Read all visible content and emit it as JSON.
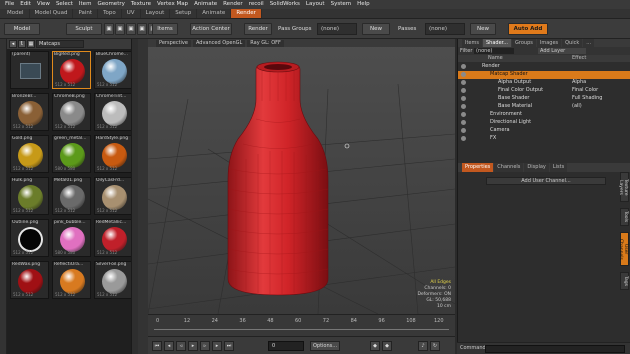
{
  "menu": [
    "File",
    "Edit",
    "View",
    "Select",
    "Item",
    "Geometry",
    "Texture",
    "Vertex Map",
    "Animate",
    "Render",
    "recoil",
    "SolidWorks",
    "Layout",
    "System",
    "Help"
  ],
  "layouts": [
    "Model",
    "Model Quad",
    "Paint",
    "Topo",
    "UV",
    "Layout",
    "Setup",
    "Animate",
    "Render"
  ],
  "active_layout": "Render",
  "toolbar": {
    "model": "Model",
    "sculpt": "Sculpt",
    "items": "Items",
    "action_center": "Action Center",
    "render": "Render",
    "pass_groups_label": "Pass Groups",
    "pass_groups_value": "(none)",
    "new1": "New",
    "passes_label": "Passes",
    "passes_value": "(none)",
    "new2": "New",
    "auto_add": "Auto Add"
  },
  "browser": {
    "filter": "Matcaps",
    "items": [
      {
        "name": "(parent)",
        "size": "",
        "color": "#3a4a55",
        "folder": true
      },
      {
        "name": "BigRed.png",
        "size": "512 x 512",
        "color": "#c0181c",
        "selected": true
      },
      {
        "name": "BlueChrome...",
        "size": "512 x 512",
        "color": "#7fa6c6"
      },
      {
        "name": "BronzeBr...",
        "size": "512 x 512",
        "color": "#8a6036"
      },
      {
        "name": "ChromeB.png",
        "size": "512 x 512",
        "color": "#8a8a8a"
      },
      {
        "name": "ChromeTint...",
        "size": "512 x 512",
        "color": "#bcbcbc"
      },
      {
        "name": "Gold.png",
        "size": "512 x 512",
        "color": "#c79a18"
      },
      {
        "name": "green_metal...",
        "size": "580 x 580",
        "color": "#5c9a1a"
      },
      {
        "name": "HardStyle.png",
        "size": "512 x 512",
        "color": "#c85a10"
      },
      {
        "name": "Hulk.png",
        "size": "512 x 512",
        "color": "#6b7d2a"
      },
      {
        "name": "Metal01.png",
        "size": "512 x 512",
        "color": "#6a6a6a"
      },
      {
        "name": "OilyCasFrd...",
        "size": "512 x 512",
        "color": "#a89070"
      },
      {
        "name": "Outline.png",
        "size": "512 x 512",
        "color": "#0a0a0a",
        "ring": true
      },
      {
        "name": "pink_bubble...",
        "size": "580 x 580",
        "color": "#e070c0"
      },
      {
        "name": "RedMetallic...",
        "size": "512 x 512",
        "color": "#c0202a"
      },
      {
        "name": "RedWax.png",
        "size": "512 x 512",
        "color": "#a01014"
      },
      {
        "name": "ReflectiOra...",
        "size": "512 x 512",
        "color": "#d87a20"
      },
      {
        "name": "SilverFoil.png",
        "size": "512 x 512",
        "color": "#9a9a9a"
      }
    ]
  },
  "viewport": {
    "tabs": [
      "Perspective",
      "Advanced OpenGL",
      "Ray GL: OFF"
    ],
    "stats": {
      "header": "All Edges",
      "channels": "Channels: 0",
      "deformers": "Deformers: ON",
      "gl": "GL: 50,688",
      "units": "10 cm"
    }
  },
  "timeline": {
    "ticks": [
      "0",
      "12",
      "24",
      "36",
      "48",
      "60",
      "72",
      "84",
      "96",
      "108",
      "120"
    ],
    "frame": "0",
    "options": "Options..."
  },
  "shader": {
    "tabs": [
      "Items",
      "Shader...",
      "Groups",
      "Images",
      "Quick",
      "..."
    ],
    "active_tab": "Shader...",
    "filter_label": "Filter",
    "filter_value": "(none)",
    "add_layer": "Add Layer",
    "col_name": "Name",
    "col_effect": "Effect",
    "rows": [
      {
        "name": "Render",
        "effect": "",
        "indent": 12
      },
      {
        "name": "Matcap Shader",
        "effect": "",
        "indent": 20,
        "hl": true
      },
      {
        "name": "Alpha Output",
        "effect": "Alpha",
        "indent": 28
      },
      {
        "name": "Final Color Output",
        "effect": "Final Color",
        "indent": 28
      },
      {
        "name": "Base Shader",
        "effect": "Full Shading",
        "indent": 28
      },
      {
        "name": "Base Material",
        "effect": "(all)",
        "indent": 28
      },
      {
        "name": "Environment",
        "effect": "",
        "indent": 20
      },
      {
        "name": "Directional Light",
        "effect": "",
        "indent": 20
      },
      {
        "name": "Camera",
        "effect": "",
        "indent": 20
      },
      {
        "name": "FX",
        "effect": "",
        "indent": 20
      }
    ]
  },
  "properties": {
    "tabs": [
      "Properties",
      "Channels",
      "Display",
      "Lists"
    ],
    "active_tab": "Properties",
    "add_channel": "Add User Channel...",
    "side_tabs": [
      "Texture Layers",
      "Tools",
      "User Channels",
      "Tags"
    ]
  },
  "command_label": "Command"
}
